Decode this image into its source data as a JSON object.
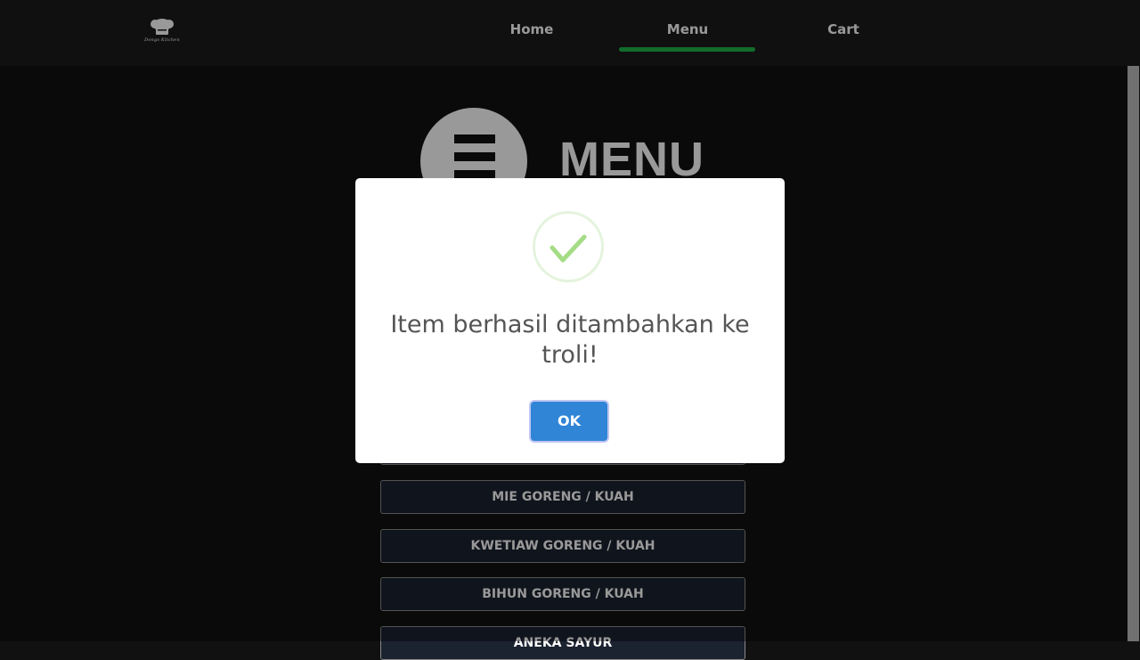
{
  "brand": {
    "logo_text": "Dongs Kitchen"
  },
  "nav": {
    "home": "Home",
    "menu": "Menu",
    "cart": "Cart",
    "active_color": "#1fb44a"
  },
  "page": {
    "heading": "MENU"
  },
  "categories": [
    "",
    "MIE GORENG / KUAH",
    "KWETIAW GORENG / KUAH",
    "BIHUN GORENG / KUAH",
    "ANEKA SAYUR"
  ],
  "dialog": {
    "icon": "success-check-icon",
    "message": "Item berhasil ditambahkan ke troli!",
    "ok_label": "OK",
    "icon_color": "#a5dc86",
    "button_color": "#3085d6"
  }
}
